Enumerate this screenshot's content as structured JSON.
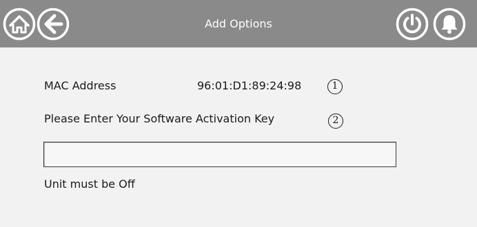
{
  "header": {
    "title": "Add Options",
    "background_color": "#8a8a8a",
    "icons": {
      "home": "home-icon",
      "back": "back-arrow-icon",
      "power": "power-icon",
      "alarm": "bell-icon"
    }
  },
  "main": {
    "mac_label": "MAC Address",
    "mac_value": "96:01:D1:89:24:98",
    "mac_badge": "1",
    "prompt": "Please Enter Your Software Activation Key",
    "prompt_badge": "2",
    "activation_key_value": "",
    "activation_key_placeholder": "",
    "status": "Unit must be Off"
  }
}
